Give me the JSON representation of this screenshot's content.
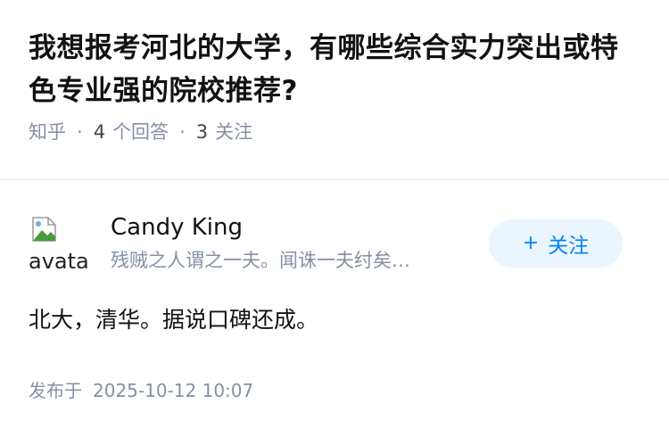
{
  "question": {
    "title": "我想报考河北的大学，有哪些综合实力突出或特色专业强的院校推荐?",
    "source": "知乎",
    "answer_count": "4",
    "answer_label": "个回答",
    "follower_count": "3",
    "follower_label": "关注"
  },
  "answer": {
    "author": {
      "name": "Candy King",
      "bio": "残贼之人谓之一夫。闻诛一夫纣矣…",
      "avatar_alt": "avatar",
      "avatar_icon": "broken-image-icon"
    },
    "follow_button": {
      "icon": "+",
      "label": "关注"
    },
    "content": "北大，清华。据说口碑还成。",
    "published_label": "发布于",
    "published_time": "2025-10-12 10:07"
  },
  "colors": {
    "accent": "#0084ff",
    "follow_bg": "#ebf5fd",
    "meta_text": "#8590a6",
    "title_text": "#121212",
    "divider": "#ebebeb"
  }
}
